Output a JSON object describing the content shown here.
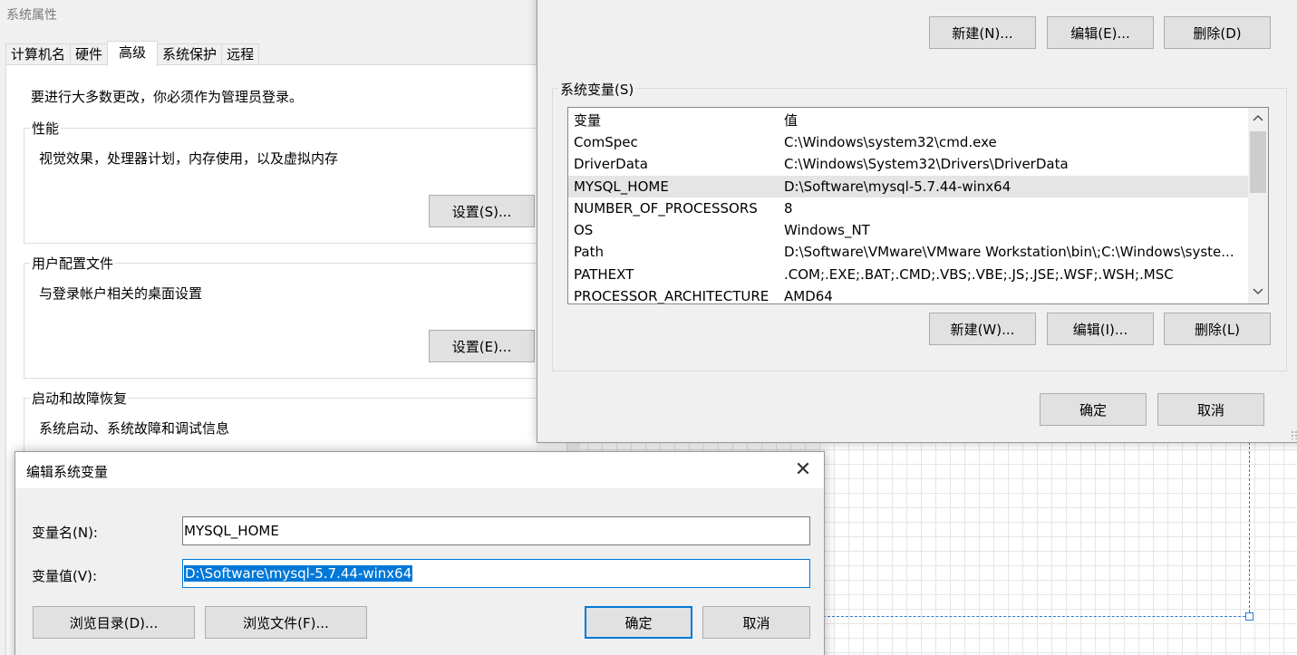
{
  "system_properties": {
    "title": "系统属性",
    "tabs": [
      {
        "label": "计算机名"
      },
      {
        "label": "硬件"
      },
      {
        "label": "高级",
        "active": true
      },
      {
        "label": "系统保护"
      },
      {
        "label": "远程"
      }
    ],
    "admin_note": "要进行大多数更改，你必须作为管理员登录。",
    "performance": {
      "legend": "性能",
      "description": "视觉效果，处理器计划，内存使用，以及虚拟内存",
      "button": "设置(S)..."
    },
    "user_profiles": {
      "legend": "用户配置文件",
      "description": "与登录帐户相关的桌面设置",
      "button": "设置(E)..."
    },
    "startup_recovery": {
      "legend": "启动和故障恢复",
      "description": "系统启动、系统故障和调试信息"
    }
  },
  "env_window": {
    "user_vars_buttons": {
      "new": "新建(N)...",
      "edit": "编辑(E)...",
      "delete": "删除(D)"
    },
    "system_vars": {
      "legend": "系统变量(S)",
      "columns": {
        "name": "变量",
        "value": "值"
      },
      "rows": [
        {
          "name": "ComSpec",
          "value": "C:\\Windows\\system32\\cmd.exe"
        },
        {
          "name": "DriverData",
          "value": "C:\\Windows\\System32\\Drivers\\DriverData"
        },
        {
          "name": "MYSQL_HOME",
          "value": "D:\\Software\\mysql-5.7.44-winx64",
          "selected": true
        },
        {
          "name": "NUMBER_OF_PROCESSORS",
          "value": "8"
        },
        {
          "name": "OS",
          "value": "Windows_NT"
        },
        {
          "name": "Path",
          "value": "D:\\Software\\VMware\\VMware Workstation\\bin\\;C:\\Windows\\syste..."
        },
        {
          "name": "PATHEXT",
          "value": ".COM;.EXE;.BAT;.CMD;.VBS;.VBE;.JS;.JSE;.WSF;.WSH;.MSC"
        },
        {
          "name": "PROCESSOR_ARCHITECTURE",
          "value": "AMD64"
        }
      ],
      "buttons": {
        "new": "新建(W)...",
        "edit": "编辑(I)...",
        "delete": "删除(L)"
      }
    },
    "ok": "确定",
    "cancel": "取消"
  },
  "edit_dialog": {
    "title": "编辑系统变量",
    "close_glyph": "✕",
    "name_label": "变量名(N):",
    "name_value": "MYSQL_HOME",
    "value_label": "变量值(V):",
    "value_value": "D:\\Software\\mysql-5.7.44-winx64",
    "browse_dir": "浏览目录(D)...",
    "browse_file": "浏览文件(F)...",
    "ok": "确定",
    "cancel": "取消"
  },
  "icons": {
    "scroll_up": "chevron-up-icon",
    "scroll_down": "chevron-down-icon",
    "close": "close-icon"
  },
  "colors": {
    "accent": "#0078d7",
    "selection_row": "#e5e5e5",
    "dialog_bg": "#f0f0f0"
  }
}
